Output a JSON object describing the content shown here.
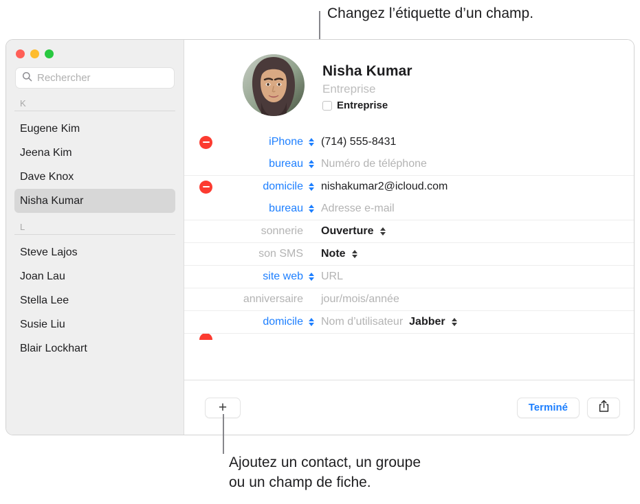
{
  "callouts": {
    "top": "Changez l’étiquette d’un champ.",
    "bottom": "Ajoutez un contact, un groupe\nou un champ de fiche."
  },
  "window": {
    "traffic_lights": {
      "close_color": "#ff5f57",
      "minimize_color": "#febc2e",
      "maximize_color": "#28c840"
    }
  },
  "sidebar": {
    "search": {
      "value": "",
      "placeholder": "Rechercher",
      "icon": "search-icon"
    },
    "groups": [
      {
        "letter": "K",
        "contacts": [
          {
            "name": "Eugene Kim",
            "selected": false
          },
          {
            "name": "Jeena Kim",
            "selected": false
          },
          {
            "name": "Dave Knox",
            "selected": false
          },
          {
            "name": "Nisha Kumar",
            "selected": true
          }
        ]
      },
      {
        "letter": "L",
        "contacts": [
          {
            "name": "Steve Lajos",
            "selected": false
          },
          {
            "name": "Joan Lau",
            "selected": false
          },
          {
            "name": "Stella Lee",
            "selected": false
          },
          {
            "name": "Susie Liu",
            "selected": false
          },
          {
            "name": "Blair Lockhart",
            "selected": false
          }
        ]
      }
    ]
  },
  "detail": {
    "name": "Nisha  Kumar",
    "company_placeholder": "Entreprise",
    "company_checkbox_label": "Entreprise",
    "company_checked": false,
    "avatar_alt": "avatar",
    "fields": [
      {
        "has_delete": true,
        "separator": false,
        "label": "iPhone",
        "label_style": "link",
        "label_stepper": true,
        "stepper_style": "blue",
        "value": "(714) 555-8431",
        "value_is_placeholder": false
      },
      {
        "has_delete": false,
        "separator": false,
        "label": "bureau",
        "label_style": "link",
        "label_stepper": true,
        "stepper_style": "blue",
        "value": "Numéro de téléphone",
        "value_is_placeholder": true
      },
      {
        "has_delete": true,
        "separator": true,
        "label": "domicile",
        "label_style": "link",
        "label_stepper": true,
        "stepper_style": "blue",
        "value": "nishakumar2@icloud.com",
        "value_is_placeholder": false
      },
      {
        "has_delete": false,
        "separator": false,
        "label": "bureau",
        "label_style": "link",
        "label_stepper": true,
        "stepper_style": "blue",
        "value": "Adresse e-mail",
        "value_is_placeholder": true
      },
      {
        "has_delete": false,
        "separator": true,
        "label": "sonnerie",
        "label_style": "dim",
        "label_stepper": false,
        "stepper_style": "dark",
        "value": "Ouverture",
        "value_is_placeholder": false,
        "value_bold": true,
        "value_stepper": true
      },
      {
        "has_delete": false,
        "separator": true,
        "label": "son SMS",
        "label_style": "dim",
        "label_stepper": false,
        "stepper_style": "dark",
        "value": "Note",
        "value_is_placeholder": false,
        "value_bold": true,
        "value_stepper": true
      },
      {
        "has_delete": false,
        "separator": true,
        "label": "site web",
        "label_style": "link",
        "label_stepper": true,
        "stepper_style": "blue",
        "value": "URL",
        "value_is_placeholder": true
      },
      {
        "has_delete": false,
        "separator": true,
        "label": "anniversaire",
        "label_style": "dim",
        "label_stepper": false,
        "stepper_style": "dark",
        "value": "jour/mois/année",
        "value_is_placeholder": true
      },
      {
        "has_delete": false,
        "separator": true,
        "label": "domicile",
        "label_style": "link",
        "label_stepper": true,
        "stepper_style": "blue",
        "value": "Nom d’utilisateur",
        "value_is_placeholder": true,
        "extra_value": "Jabber",
        "extra_value_bold": true,
        "extra_stepper": true
      }
    ]
  },
  "bottom_bar": {
    "add_label": "+",
    "done_label": "Terminé",
    "share_icon": "share-icon"
  },
  "colors": {
    "accent_blue": "#1d7fff",
    "delete_red": "#fc3b30",
    "sidebar_bg": "#efefef",
    "selection_bg": "#d7d7d7"
  }
}
